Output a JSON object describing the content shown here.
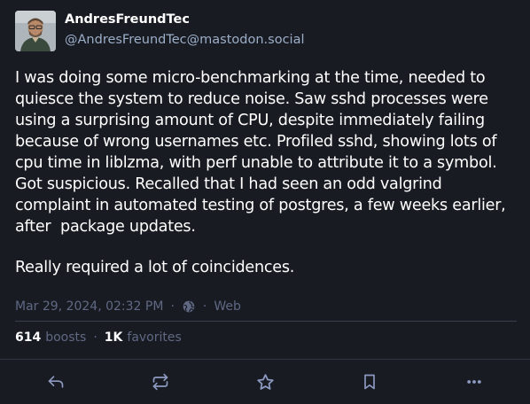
{
  "account": {
    "display_name": "AndresFreundTec",
    "handle": "@AndresFreundTec@mastodon.social"
  },
  "content": {
    "paragraphs": [
      "I was doing some micro-benchmarking at the time, needed to quiesce the system to reduce noise. Saw sshd processes were using a surprising amount of CPU, despite immediately failing because of wrong usernames etc. Profiled sshd, showing lots of cpu time in liblzma, with perf unable to attribute it to a symbol. Got suspicious. Recalled that I had seen an odd valgrind complaint in automated testing of postgres, a few weeks earlier, after  package updates.",
      "Really required a lot of coincidences."
    ]
  },
  "meta": {
    "timestamp": "Mar 29, 2024, 02:32 PM",
    "dot": "·",
    "visibility_icon": "globe-icon",
    "application": "Web"
  },
  "counts": {
    "boosts_count": "614",
    "boosts_label": "boosts",
    "favorites_count": "1K",
    "favorites_label": "favorites",
    "separator": "·"
  },
  "actions": {
    "reply_icon": "reply-icon",
    "boost_icon": "boost-icon",
    "favorite_icon": "star-icon",
    "bookmark_icon": "bookmark-icon",
    "more_icon": "more-icon"
  },
  "colors": {
    "background": "#191b22",
    "text": "#ffffff",
    "handle": "#9baec8",
    "muted": "#606984",
    "icon": "#8d9ac2"
  }
}
